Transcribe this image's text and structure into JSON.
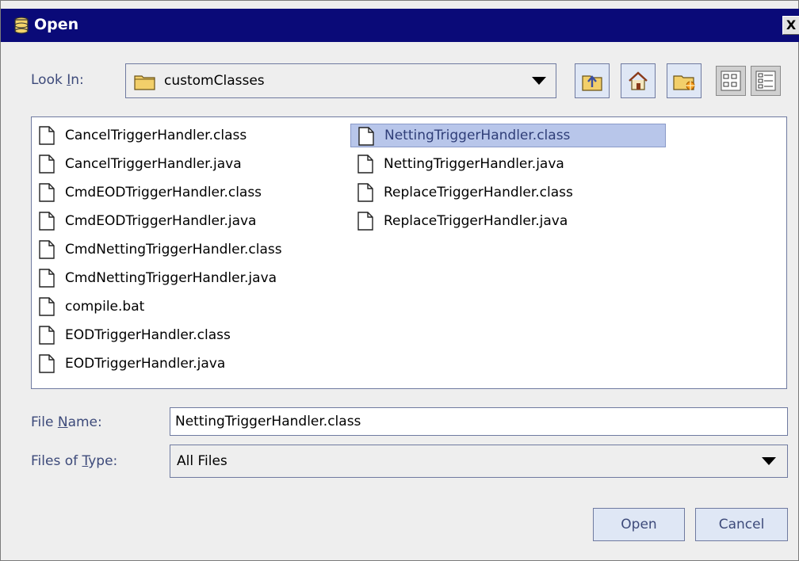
{
  "window": {
    "title": "Open",
    "close_label": "X"
  },
  "look_in": {
    "label_prefix": "Look ",
    "label_mnemonic": "I",
    "label_suffix": "n:",
    "value": "customClasses"
  },
  "toolbar": {
    "icons": [
      "up-one-level-icon",
      "home-icon",
      "new-folder-icon",
      "list-view-icon",
      "details-view-icon"
    ]
  },
  "files": {
    "column1": [
      "CancelTriggerHandler.class",
      "CancelTriggerHandler.java",
      "CmdEODTriggerHandler.class",
      "CmdEODTriggerHandler.java",
      "CmdNettingTriggerHandler.class",
      "CmdNettingTriggerHandler.java",
      "compile.bat",
      "EODTriggerHandler.class",
      "EODTriggerHandler.java"
    ],
    "column2": [
      "NettingTriggerHandler.class",
      "NettingTriggerHandler.java",
      "ReplaceTriggerHandler.class",
      "ReplaceTriggerHandler.java"
    ],
    "selected": "NettingTriggerHandler.class"
  },
  "file_name": {
    "label_prefix": "File ",
    "label_mnemonic": "N",
    "label_suffix": "ame:",
    "value": "NettingTriggerHandler.class"
  },
  "file_type": {
    "label_prefix": "Files of ",
    "label_mnemonic": "T",
    "label_suffix": "ype:",
    "value": "All Files"
  },
  "buttons": {
    "open": "Open",
    "cancel": "Cancel"
  },
  "colors": {
    "titlebar": "#0a0a78",
    "label_text": "#3d4a7a",
    "selection": "#b8c6ea",
    "button_face": "#dfe7f5"
  }
}
